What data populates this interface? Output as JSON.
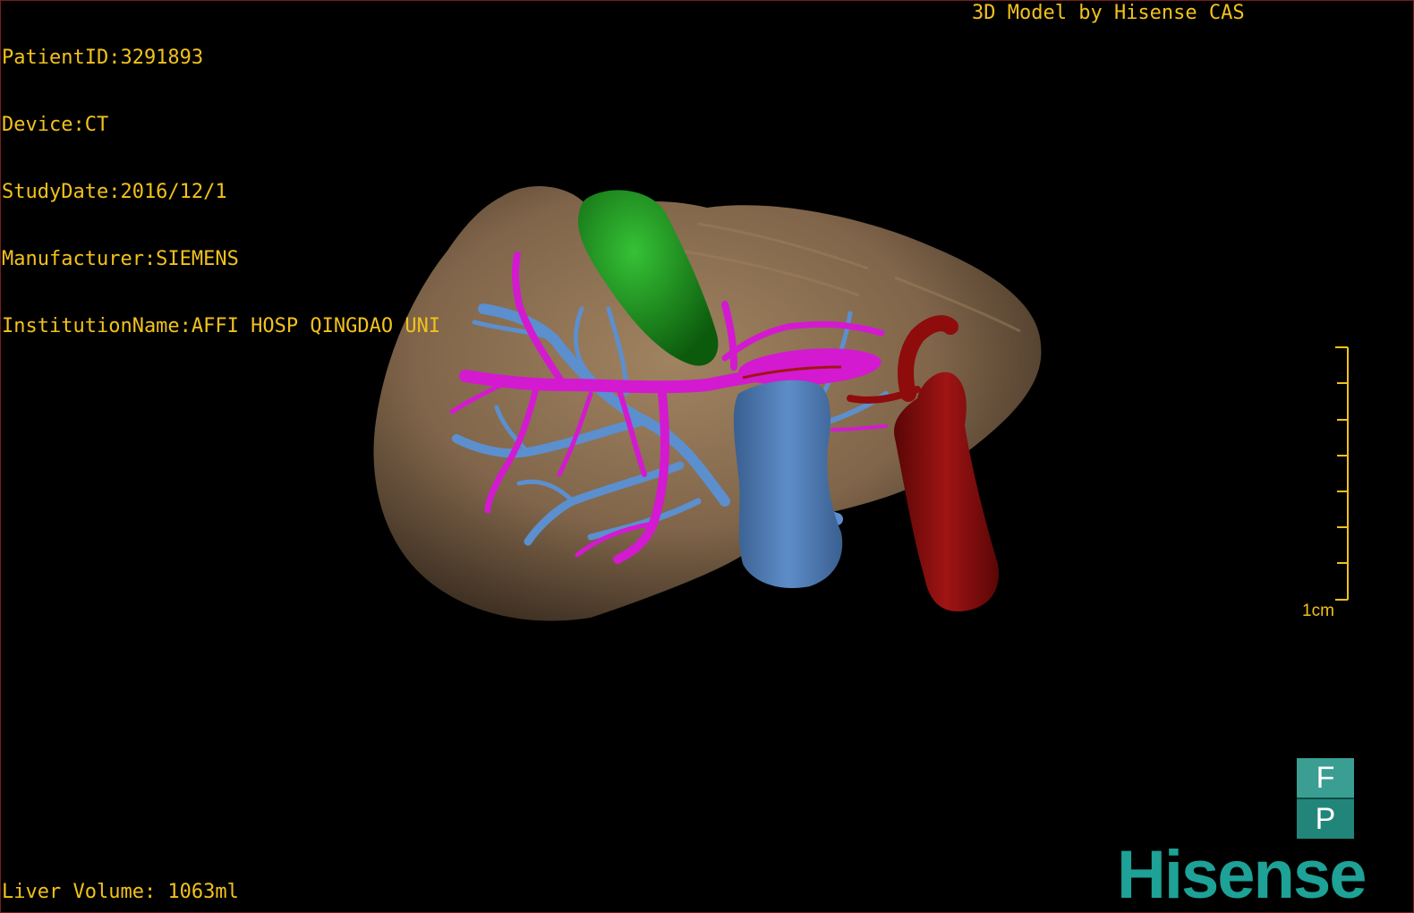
{
  "header": {
    "patient_id": "PatientID:3291893",
    "device": "Device:CT",
    "study_date": "StudyDate:2016/12/1",
    "manufacturer": "Manufacturer:SIEMENS",
    "institution": "InstitutionName:AFFI HOSP QINGDAO UNI",
    "brand_title": "3D Model by Hisense CAS"
  },
  "footer": {
    "liver_volume": "Liver Volume: 1063ml"
  },
  "scale_bar": {
    "label": "1cm",
    "tick_count": 8
  },
  "orientation_cube": {
    "top_letter": "F",
    "bottom_letter": "P"
  },
  "logo": {
    "text": "Hisense"
  },
  "colors": {
    "overlay_text": "#f2c21c",
    "liver": "#8a6e4f",
    "gallbladder": "#1c8c1c",
    "portal_vein": "#d31ad0",
    "hepatic_vein": "#5c8fce",
    "ivc": "#4a78b4",
    "aorta": "#8e0c0c",
    "brand": "#1ea196"
  },
  "icons": [
    "fp-orientation-icon",
    "scale-bar-icon",
    "hisense-logo"
  ]
}
